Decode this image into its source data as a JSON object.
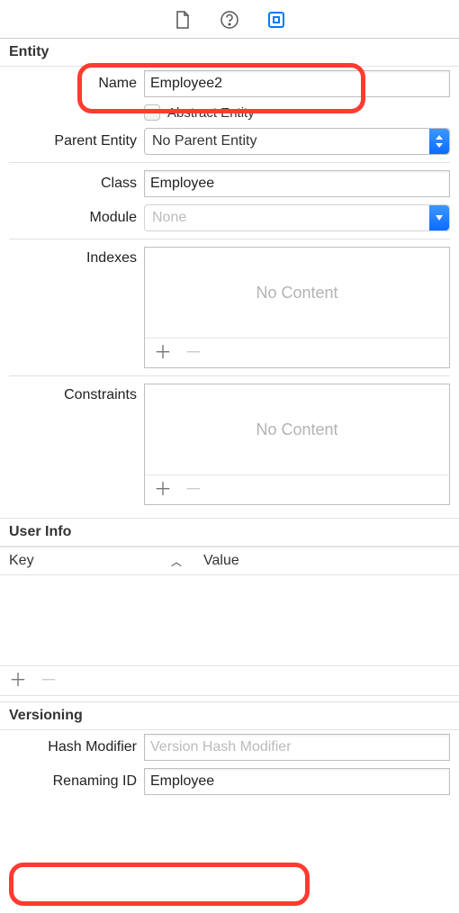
{
  "toolbar": {
    "icons": [
      "document-icon",
      "help-icon",
      "inspector-icon"
    ]
  },
  "entity": {
    "title": "Entity",
    "name_label": "Name",
    "name_value": "Employee2",
    "abstract_label": "Abstract Entity",
    "abstract_checked": false,
    "parent_label": "Parent Entity",
    "parent_value": "No Parent Entity",
    "class_label": "Class",
    "class_value": "Employee",
    "module_label": "Module",
    "module_value": "None",
    "indexes_label": "Indexes",
    "indexes_placeholder": "No Content",
    "constraints_label": "Constraints",
    "constraints_placeholder": "No Content"
  },
  "userinfo": {
    "title": "User Info",
    "key_label": "Key",
    "value_label": "Value"
  },
  "versioning": {
    "title": "Versioning",
    "hash_label": "Hash Modifier",
    "hash_placeholder": "Version Hash Modifier",
    "hash_value": "",
    "renaming_label": "Renaming ID",
    "renaming_value": "Employee"
  }
}
